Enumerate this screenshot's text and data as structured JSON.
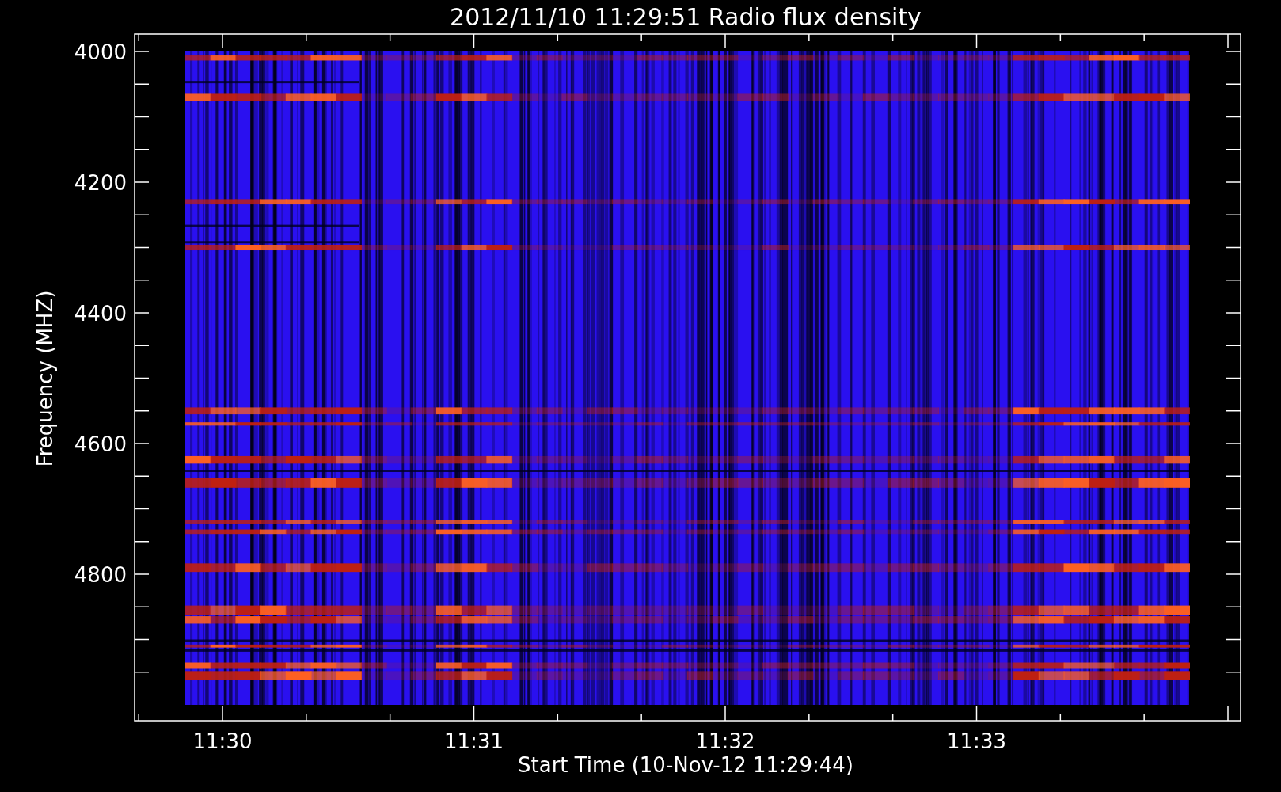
{
  "title": "2012/11/10 11:29:51 Radio flux density",
  "plot": {
    "ylabel": "Frequency (MHZ)",
    "xlabel": "Start Time (10-Nov-12 11:29:44)",
    "yticks": [
      "4000",
      "4200",
      "4400",
      "4600",
      "4800"
    ],
    "xticks": [
      "11:30",
      "11:31",
      "11:32",
      "11:33"
    ]
  }
}
